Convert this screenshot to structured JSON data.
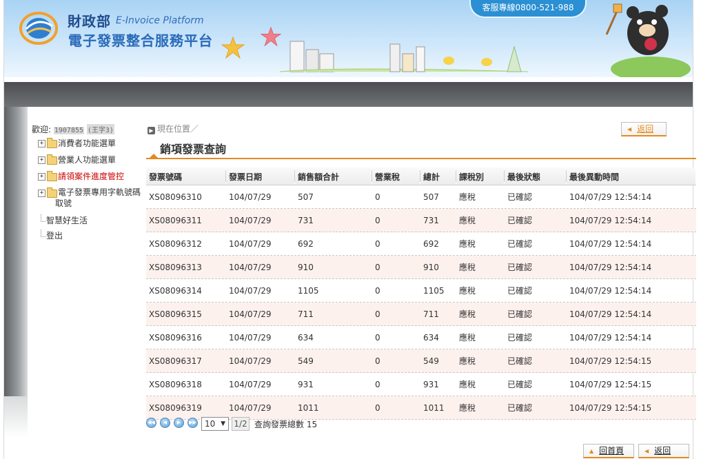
{
  "header": {
    "ministry": "財政部",
    "platform_en": "E-Invoice Platform",
    "platform_zh": "電子發票整合服務平台",
    "hotline": "客服專線0800-521-988"
  },
  "sidebar": {
    "welcome_prefix": "歡迎:",
    "user_id_masked": "1907855",
    "user_name_masked": "(王字3)",
    "items": [
      {
        "label": "消費者功能選單",
        "expander": "+"
      },
      {
        "label": "營業人功能選單",
        "expander": "+"
      },
      {
        "label": "請領案件進度管控",
        "expander": "+"
      },
      {
        "label": "電子發票專用字軌號碼取號",
        "expander": "+"
      }
    ],
    "plain_items": [
      {
        "label": "智慧好生活"
      },
      {
        "label": "登出"
      }
    ]
  },
  "breadcrumb": {
    "text": "現在位置／"
  },
  "page": {
    "title": "銷項發票查詢",
    "back_top": "返回",
    "home_button": "回首頁",
    "back_bottom": "返回"
  },
  "table": {
    "headers": [
      "發票號碼",
      "發票日期",
      "銷售額合計",
      "營業稅",
      "總計",
      "課稅別",
      "最後狀態",
      "最後異動時間"
    ],
    "rows": [
      [
        "XS08096310",
        "104/07/29",
        "507",
        "0",
        "507",
        "應稅",
        "已確認",
        "104/07/29 12:54:14"
      ],
      [
        "XS08096311",
        "104/07/29",
        "731",
        "0",
        "731",
        "應稅",
        "已確認",
        "104/07/29 12:54:14"
      ],
      [
        "XS08096312",
        "104/07/29",
        "692",
        "0",
        "692",
        "應稅",
        "已確認",
        "104/07/29 12:54:14"
      ],
      [
        "XS08096313",
        "104/07/29",
        "910",
        "0",
        "910",
        "應稅",
        "已確認",
        "104/07/29 12:54:14"
      ],
      [
        "XS08096314",
        "104/07/29",
        "1105",
        "0",
        "1105",
        "應稅",
        "已確認",
        "104/07/29 12:54:14"
      ],
      [
        "XS08096315",
        "104/07/29",
        "711",
        "0",
        "711",
        "應稅",
        "已確認",
        "104/07/29 12:54:14"
      ],
      [
        "XS08096316",
        "104/07/29",
        "634",
        "0",
        "634",
        "應稅",
        "已確認",
        "104/07/29 12:54:14"
      ],
      [
        "XS08096317",
        "104/07/29",
        "549",
        "0",
        "549",
        "應稅",
        "已確認",
        "104/07/29 12:54:15"
      ],
      [
        "XS08096318",
        "104/07/29",
        "931",
        "0",
        "931",
        "應稅",
        "已確認",
        "104/07/29 12:54:15"
      ],
      [
        "XS08096319",
        "104/07/29",
        "1011",
        "0",
        "1011",
        "應稅",
        "已確認",
        "104/07/29 12:54:15"
      ]
    ]
  },
  "pager": {
    "page_size": "10",
    "page_info": "1/2",
    "total_label": "查詢發票總數",
    "total_count": "15",
    "icons": [
      "first-page-icon",
      "prev-page-icon",
      "next-page-icon",
      "last-page-icon"
    ]
  },
  "colors": {
    "accent": "#e38a1f",
    "alt_row": "#fdf1ee",
    "active_menu": "#cc0000"
  }
}
